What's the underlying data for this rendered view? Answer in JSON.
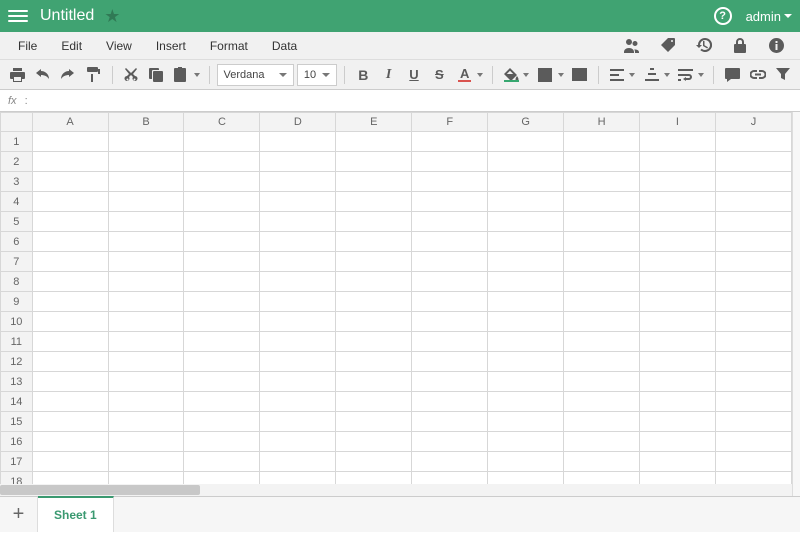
{
  "title": "Untitled",
  "user": "admin",
  "menus": {
    "file": "File",
    "edit": "Edit",
    "view": "View",
    "insert": "Insert",
    "format": "Format",
    "data": "Data"
  },
  "font": {
    "name": "Verdana",
    "size": "10"
  },
  "fxlabel": "fx",
  "columns": [
    "A",
    "B",
    "C",
    "D",
    "E",
    "F",
    "G",
    "H",
    "I",
    "J"
  ],
  "rows": [
    "1",
    "2",
    "3",
    "4",
    "5",
    "6",
    "7",
    "8",
    "9",
    "10",
    "11",
    "12",
    "13",
    "14",
    "15",
    "16",
    "17",
    "18"
  ],
  "sheet": {
    "add": "+",
    "tab1": "Sheet 1"
  }
}
